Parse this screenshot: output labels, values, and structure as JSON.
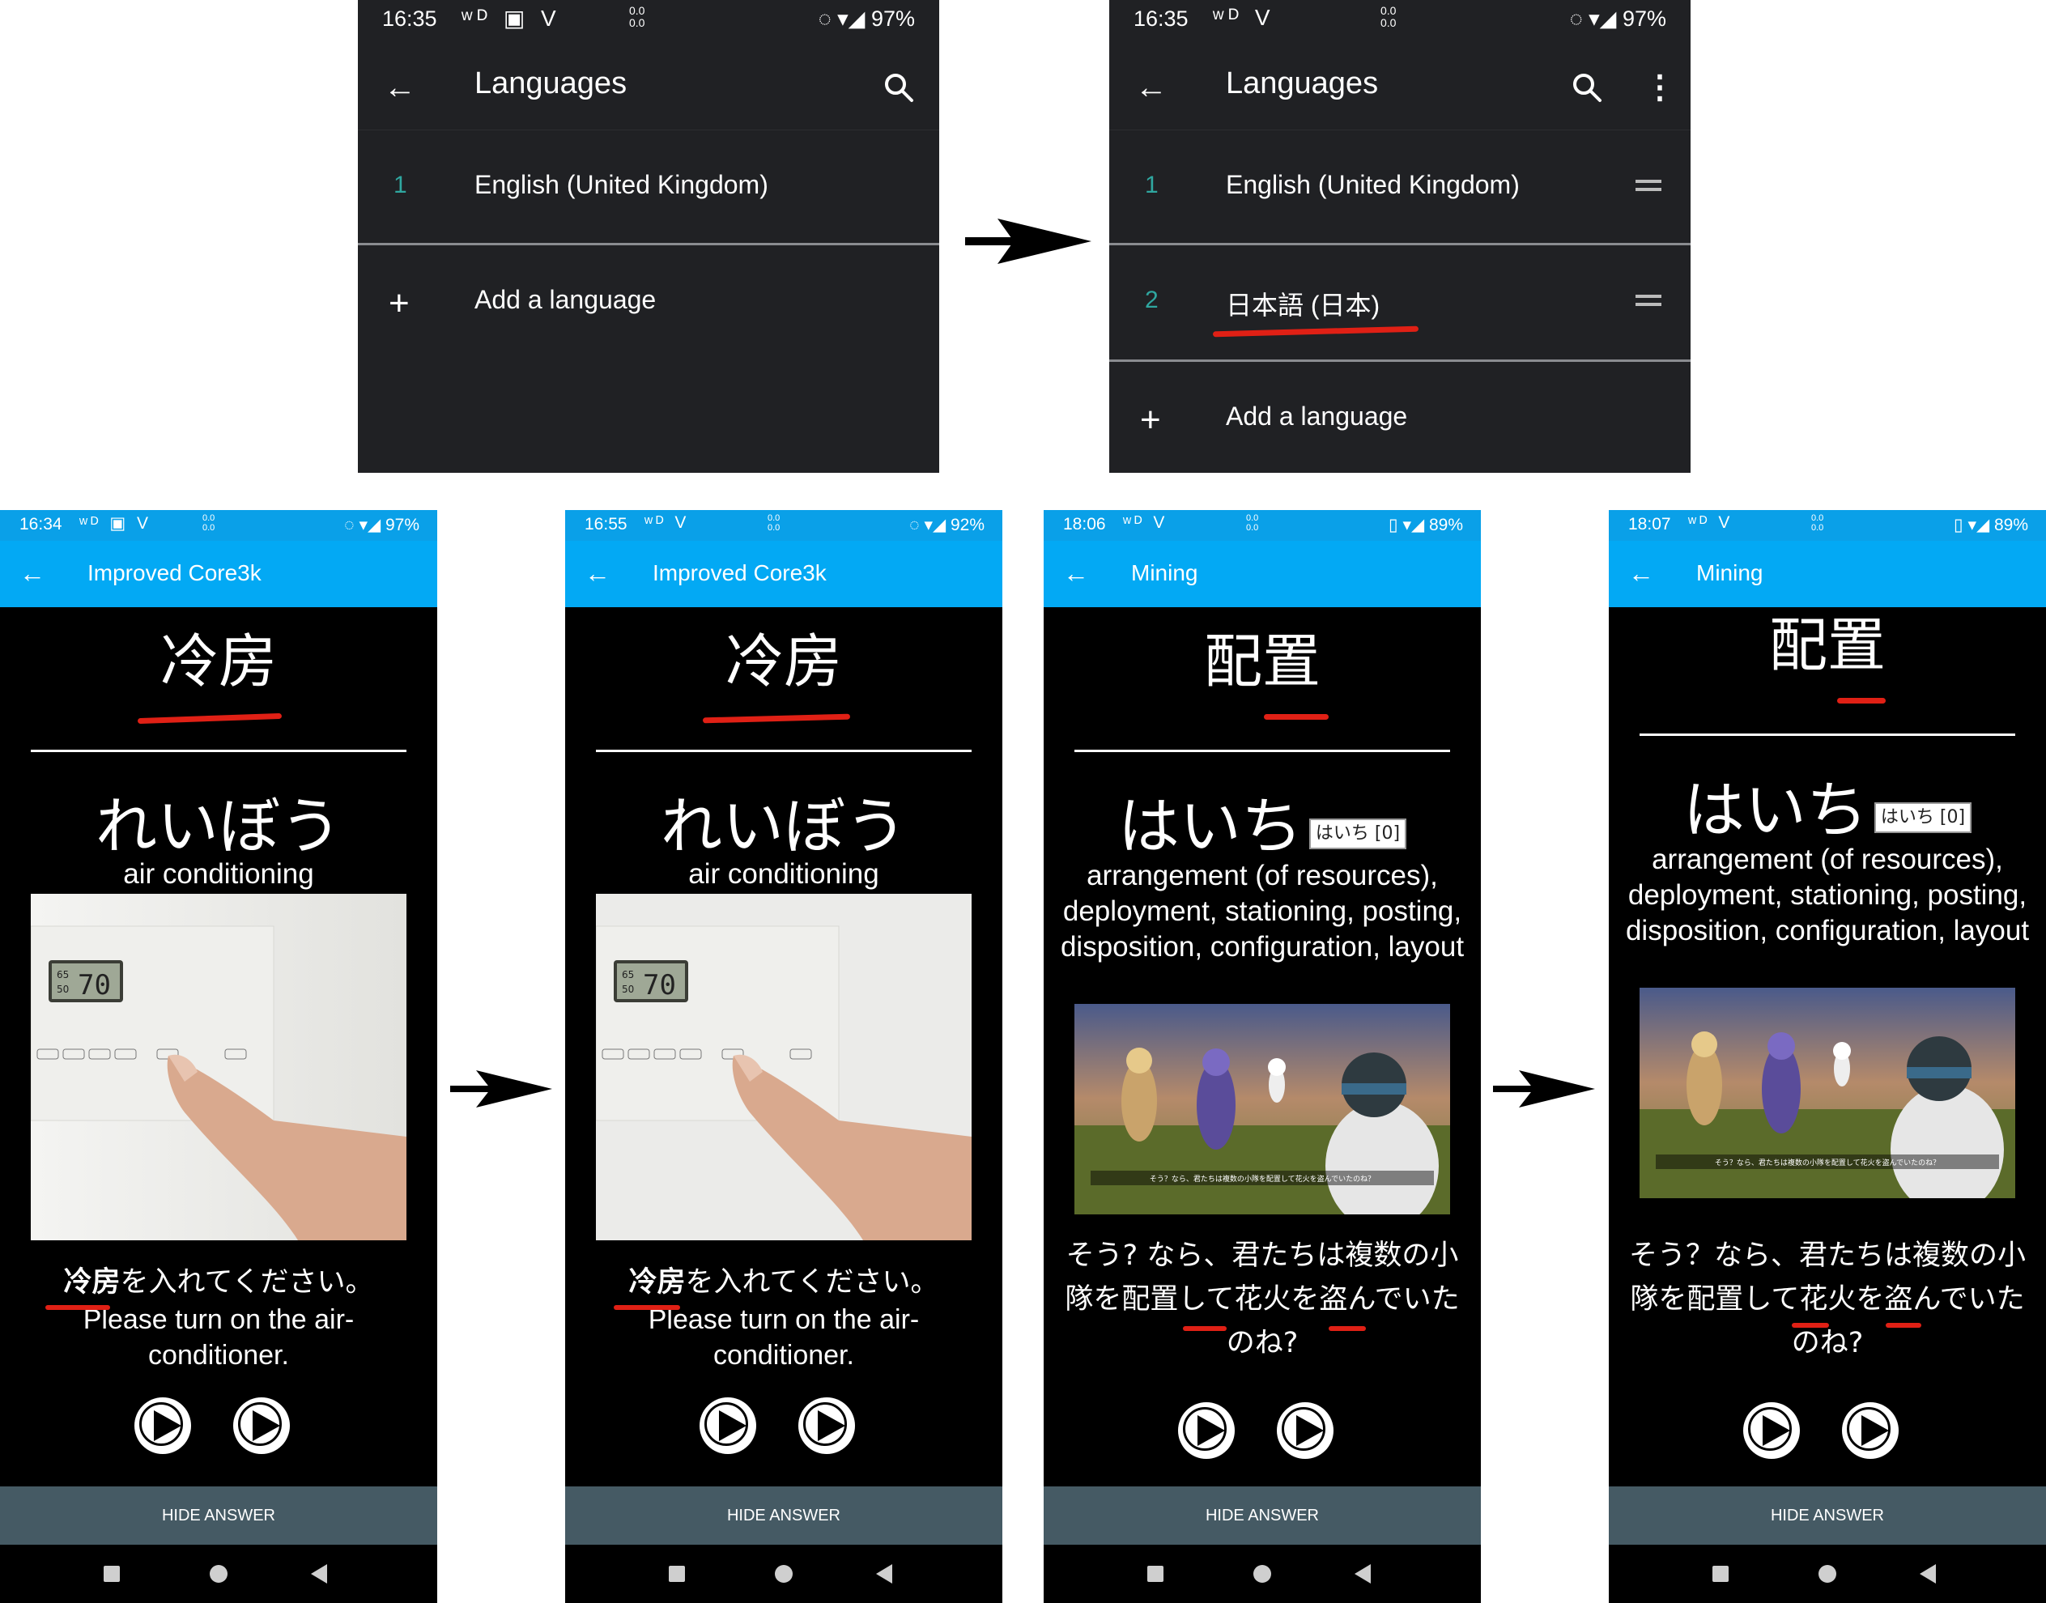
{
  "settings_before": {
    "status": {
      "time": "16:35",
      "icons": "ʷᴰ ▣ V",
      "net_up": "0.0",
      "net_down": "0.0",
      "battery": "97%"
    },
    "title": "Languages",
    "languages": [
      {
        "num": "1",
        "label": "English (United Kingdom)"
      }
    ],
    "add_label": "Add a language"
  },
  "settings_after": {
    "status": {
      "time": "16:35",
      "icons": "ʷᴰ V",
      "net_up": "0.0",
      "net_down": "0.0",
      "battery": "97%"
    },
    "title": "Languages",
    "languages": [
      {
        "num": "1",
        "label": "English (United Kingdom)"
      },
      {
        "num": "2",
        "label": "日本語 (日本)"
      }
    ],
    "add_label": "Add a language"
  },
  "cards": [
    {
      "status": {
        "time": "16:34",
        "icons": "ʷᴰ ▣ V",
        "net_up": "0.0",
        "net_down": "0.0",
        "battery": "97%"
      },
      "deck": "Improved Core3k",
      "term": "冷房",
      "reading": "れいぼう",
      "pill": "",
      "meaning": "air conditioning",
      "picture": "thermostat",
      "sentence_jp_hl": "冷房",
      "sentence_jp_rest": "を入れてください。",
      "sentence_en": "Please turn on the air-conditioner.",
      "hide_label": "HIDE ANSWER"
    },
    {
      "status": {
        "time": "16:55",
        "icons": "ʷᴰ V",
        "net_up": "0.0",
        "net_down": "0.0",
        "battery": "92%"
      },
      "deck": "Improved Core3k",
      "term": "冷房",
      "reading": "れいぼう",
      "pill": "",
      "meaning": "air conditioning",
      "picture": "thermostat",
      "sentence_jp_hl": "冷房",
      "sentence_jp_rest": "を入れてください。",
      "sentence_en": "Please turn on the air-conditioner.",
      "hide_label": "HIDE ANSWER"
    },
    {
      "status": {
        "time": "18:06",
        "icons": "ʷᴰ V",
        "net_up": "0.0",
        "net_down": "0.0",
        "battery": "89%"
      },
      "deck": "Mining",
      "term": "配置",
      "reading": "はいち",
      "pill": "はいち [0]",
      "meaning": "arrangement (of resources), deployment, stationing, posting, disposition, configuration, layout",
      "picture": "game-scene",
      "picture_caption": "そう？なら、君たちは複数の小隊を配置して花火を盗んでいたのね？",
      "sentence_jp": "そう? なら、君たちは複数の小隊を配置して花火を盗んでいたのね?",
      "hide_label": "HIDE ANSWER"
    },
    {
      "status": {
        "time": "18:07",
        "icons": "ʷᴰ V",
        "net_up": "0.0",
        "net_down": "0.0",
        "battery": "89%"
      },
      "deck": "Mining",
      "term": "配置",
      "reading": "はいち",
      "pill": "はいち [0]",
      "meaning": "arrangement (of resources), deployment, stationing, posting, disposition, configuration, layout",
      "picture": "game-scene",
      "picture_caption": "そう？なら、君たちは複数の小隊を配置して花火を盗んでいたのね？",
      "sentence_jp": "そう？なら、君たちは複数の小隊を配置して花火を盗んでいたのね?",
      "hide_label": "HIDE ANSWER"
    }
  ],
  "thermostat_display": {
    "small_top": "65",
    "small_bottom": "50",
    "big": "70"
  },
  "colors": {
    "appbar": "#03a9f4",
    "statusbar": "#0aa0e8",
    "hide_bar": "#455a64",
    "settings_bg": "#202124",
    "accent_num": "#2fa7a0",
    "annotation": "#e02015"
  },
  "icons": [
    "back-arrow-icon",
    "search-icon",
    "more-vert-icon",
    "drag-handle-icon",
    "plus-icon",
    "play-icon",
    "recents-icon",
    "home-icon",
    "back-triangle-icon",
    "right-arrow-icon"
  ]
}
